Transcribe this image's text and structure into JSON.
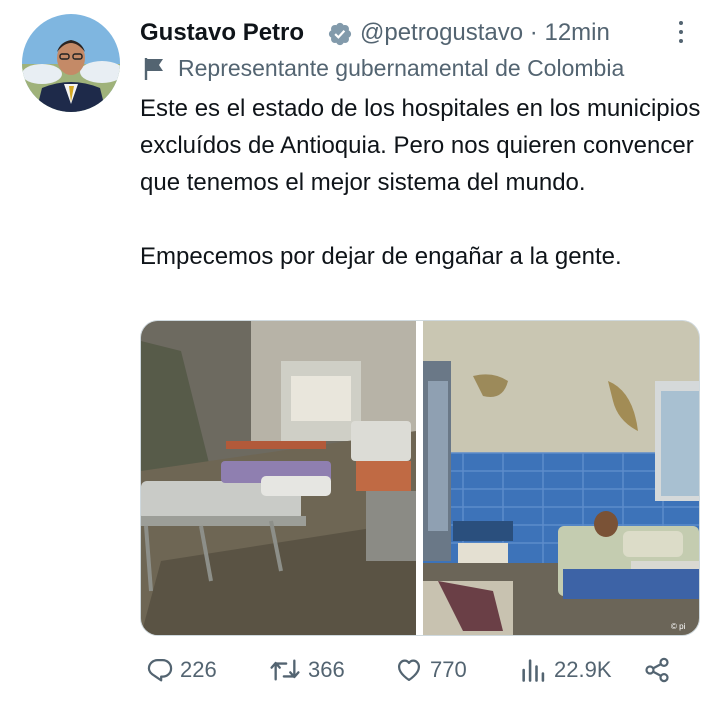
{
  "user": {
    "name": "Gustavo Petro",
    "handle": "@petrogustavo",
    "separator": "·",
    "time": "12min",
    "affiliation": "Representante gubernamental de Colombia"
  },
  "tweet": {
    "text": "Este es el estado de los hospitales en los municipios excluídos de Antioquia.  Pero nos quieren convencer que tenemos el mejor sistema del mundo.\n\nEmpecemos por dejar de engañar a la gente."
  },
  "media": {
    "watermark": "© pi"
  },
  "actions": {
    "replies": "226",
    "retweets": "366",
    "likes": "770",
    "views": "22.9K"
  },
  "colors": {
    "text": "#0f1419",
    "secondary": "#536471",
    "verified": "#829aab",
    "border": "#cfd9de"
  },
  "icons": [
    "verified-badge-icon",
    "more-icon",
    "flag-icon",
    "reply-icon",
    "retweet-icon",
    "like-icon",
    "views-icon",
    "share-icon"
  ]
}
